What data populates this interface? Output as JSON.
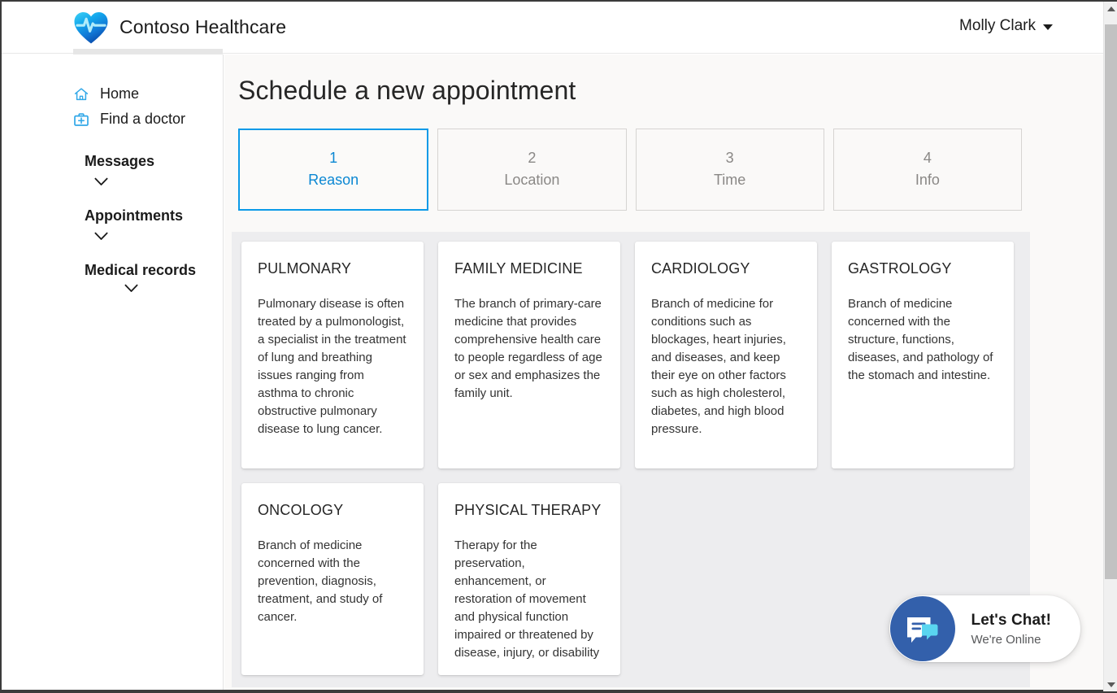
{
  "header": {
    "brand_name": "Contoso Healthcare",
    "logo_icon": "heart-pulse-icon",
    "user_name": "Molly Clark",
    "user_caret_icon": "caret-down-icon"
  },
  "sidebar": {
    "links": [
      {
        "label": "Home",
        "icon": "home-icon"
      },
      {
        "label": "Find a doctor",
        "icon": "doctor-bag-icon"
      }
    ],
    "groups": [
      {
        "label": "Messages",
        "icon": "chevron-down-icon"
      },
      {
        "label": "Appointments",
        "icon": "chevron-down-icon"
      },
      {
        "label": "Medical records",
        "icon": "chevron-down-icon"
      }
    ]
  },
  "main": {
    "page_title": "Schedule a new appointment",
    "steps": [
      {
        "number": "1",
        "label": "Reason",
        "active": true
      },
      {
        "number": "2",
        "label": "Location",
        "active": false
      },
      {
        "number": "3",
        "label": "Time",
        "active": false
      },
      {
        "number": "4",
        "label": "Info",
        "active": false
      }
    ],
    "cards": [
      {
        "title": "PULMONARY",
        "desc": "Pulmonary disease is often treated by a pulmonologist, a specialist in the treatment of lung and breathing issues ranging from asthma to chronic obstructive pulmonary disease to lung cancer."
      },
      {
        "title": "FAMILY MEDICINE",
        "desc": "The branch of primary-care medicine that provides comprehensive health care to people regardless of age or sex and emphasizes the family unit."
      },
      {
        "title": "CARDIOLOGY",
        "desc": "Branch of medicine for conditions such as blockages, heart injuries, and diseases, and keep their eye on other factors such as high cholesterol, diabetes, and high blood pressure."
      },
      {
        "title": "GASTROLOGY",
        "desc": "Branch of medicine concerned with the structure, functions, diseases, and pathology of the stomach and intestine."
      },
      {
        "title": "ONCOLOGY",
        "desc": "Branch of medicine concerned with the prevention, diagnosis, treatment, and study of cancer."
      },
      {
        "title": "PHYSICAL THERAPY",
        "desc": "Therapy for the preservation, enhancement, or restoration of movement and physical function impaired or threatened by disease, injury, or disability"
      }
    ]
  },
  "chat": {
    "title": "Let's Chat!",
    "subtitle": "We're Online",
    "icon": "chat-bubble-icon"
  },
  "scrollbar": {
    "up_icon": "scroll-up-arrow-icon",
    "down_icon": "scroll-down-arrow-icon"
  },
  "colors": {
    "accent_blue": "#0b9ae8",
    "accent_blue_text": "#0b87d3",
    "icon_blue": "#32a8e8",
    "chat_avatar": "#3360ab",
    "chat_bubble_cyan": "#5ad5f0",
    "panel_grey": "#ededef",
    "content_bg": "#faf9f8"
  }
}
